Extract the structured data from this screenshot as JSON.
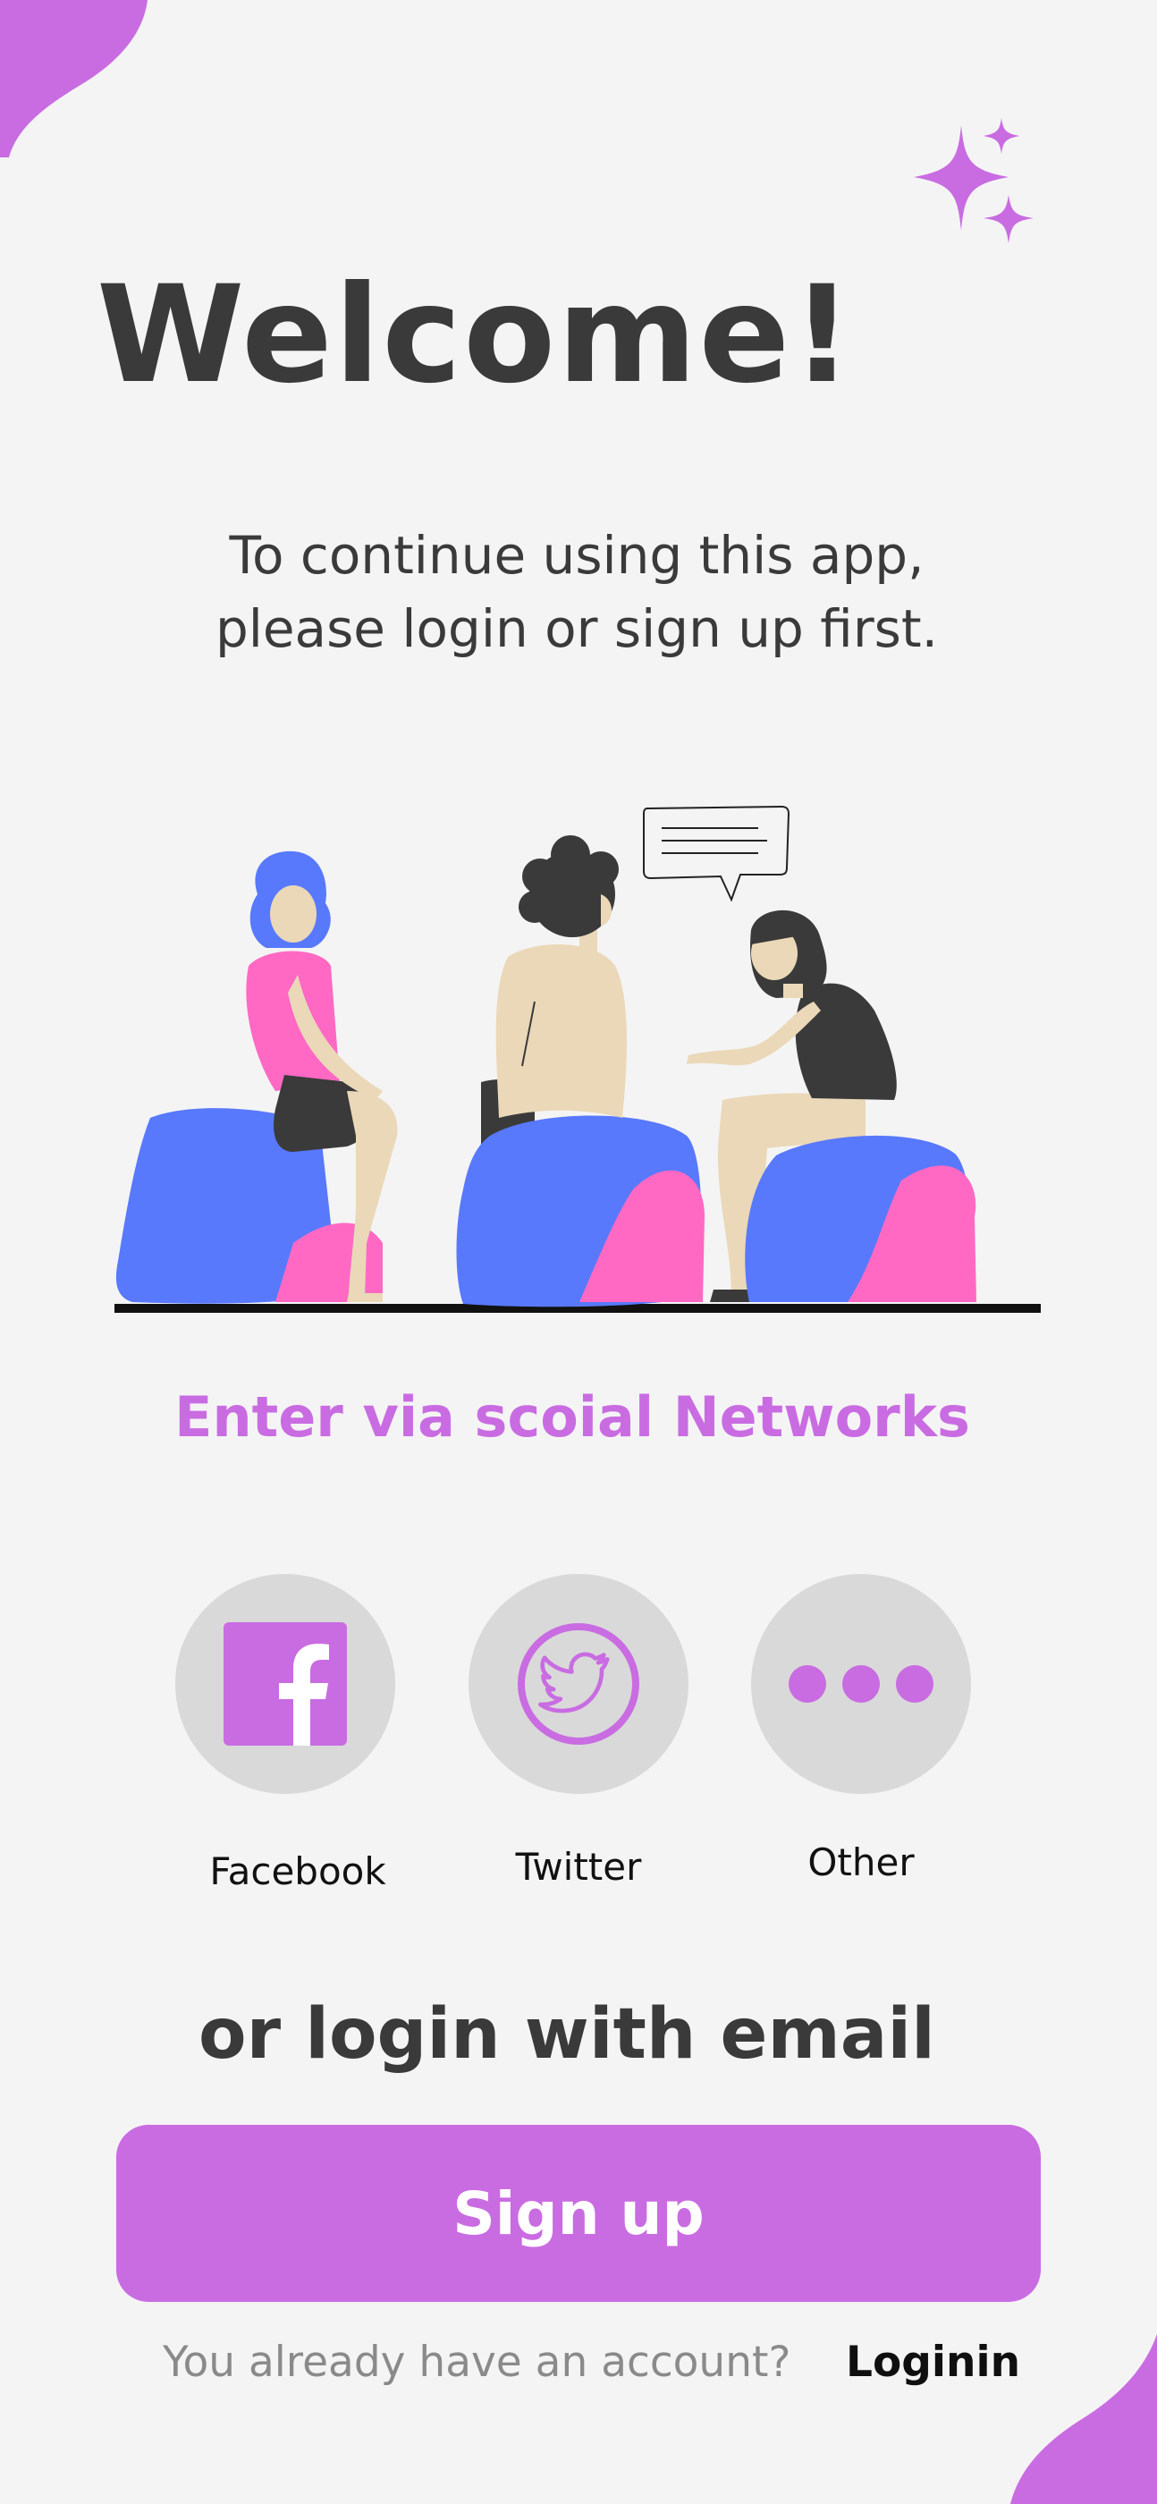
{
  "header": {
    "title": "Welcome!",
    "subtitle_line1": "To continue using this app,",
    "subtitle_line2": "please login or sign up first."
  },
  "social": {
    "heading": "Enter via scoial Networks",
    "items": [
      {
        "label": "Facebook",
        "icon": "facebook-icon"
      },
      {
        "label": "Twitter",
        "icon": "twitter-bird-icon"
      },
      {
        "label": "Other",
        "icon": "more-dots-icon"
      }
    ]
  },
  "email": {
    "heading": "or login with email"
  },
  "signup": {
    "label": "Sign up"
  },
  "footer": {
    "prompt": "You already have an account?",
    "login_label": "Loginin"
  },
  "colors": {
    "accent": "#c96ce2",
    "background": "#f4f4f4",
    "button_gray": "#d9d9d9",
    "text_dark": "#3a3a3a",
    "chair_blue": "#5879fc",
    "chair_pink": "#ff69c4",
    "skin": "#ead8b8"
  }
}
